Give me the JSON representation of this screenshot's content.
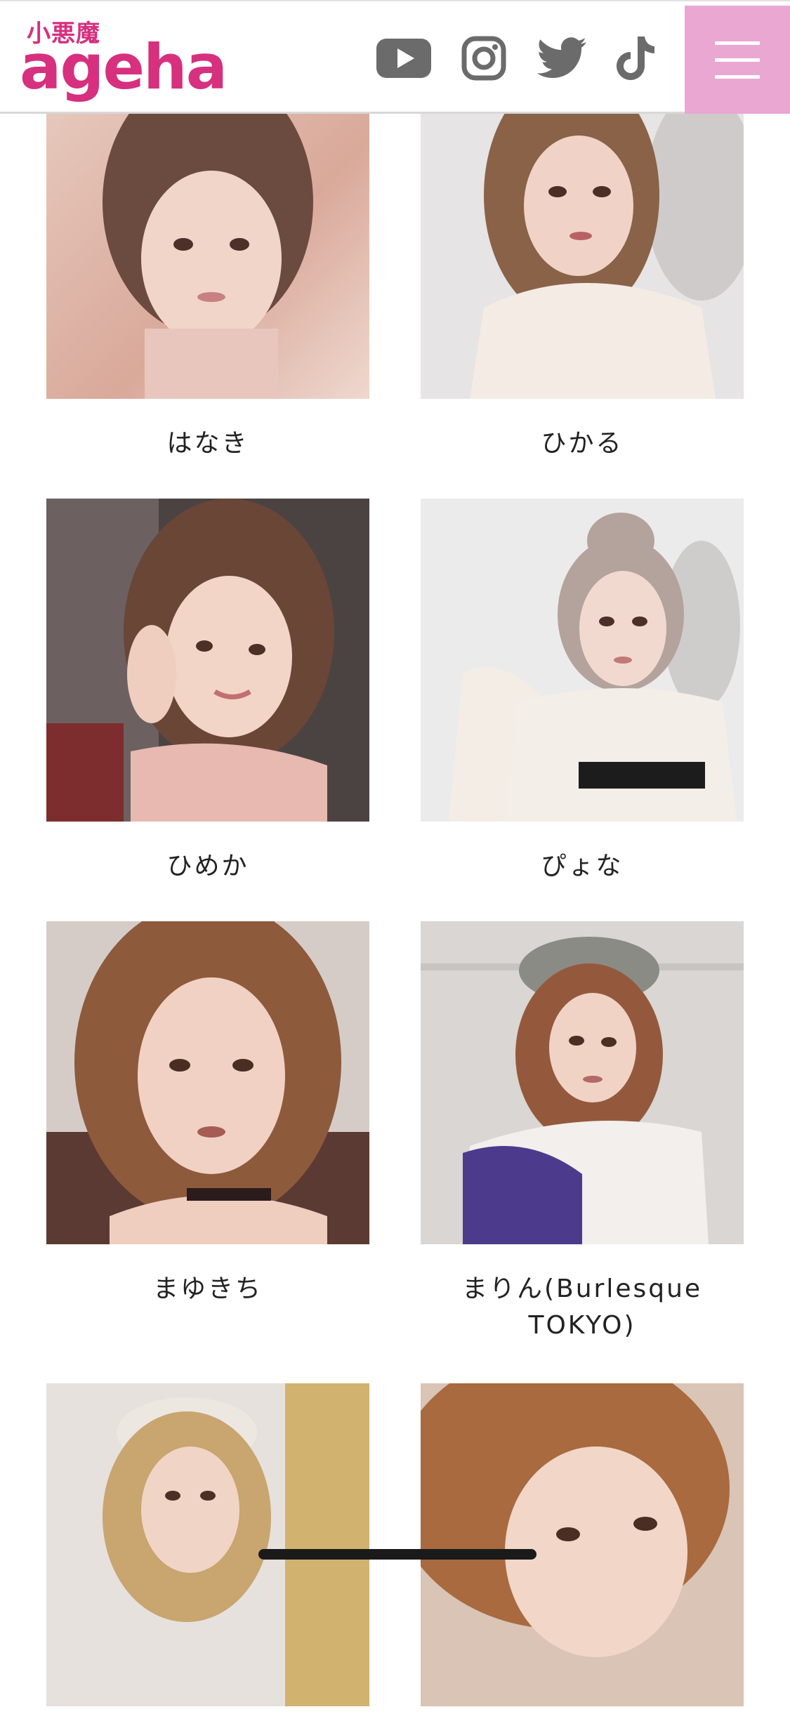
{
  "header": {
    "logo_small": "小悪魔",
    "logo_big": "ageha",
    "social_icons": [
      "youtube-icon",
      "instagram-icon",
      "twitter-icon",
      "tiktok-icon"
    ],
    "menu_icon": "hamburger-menu-icon",
    "colors": {
      "brand": "#d6307f",
      "menu_bg": "#e9a7d2",
      "icon": "#6b6b6b"
    }
  },
  "models": [
    {
      "name": "はなき",
      "photo": "portrait-photo"
    },
    {
      "name": "ひかる",
      "photo": "portrait-photo"
    },
    {
      "name": "ひめか",
      "photo": "portrait-photo"
    },
    {
      "name": "ぴょな",
      "photo": "portrait-photo"
    },
    {
      "name": "まゆきち",
      "photo": "portrait-photo"
    },
    {
      "name": "まりん(Burlesque TOKYO)",
      "photo": "portrait-photo"
    },
    {
      "name": "",
      "photo": "portrait-photo"
    },
    {
      "name": "",
      "photo": "portrait-photo"
    }
  ]
}
